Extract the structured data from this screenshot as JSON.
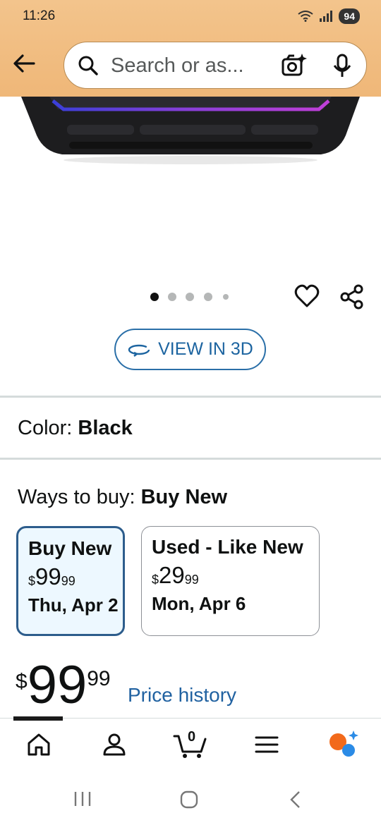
{
  "status_bar": {
    "time": "11:26",
    "battery": "94"
  },
  "search": {
    "placeholder": "Search or as..."
  },
  "color": {
    "label": "Color:",
    "value": "Black"
  },
  "view_3d": {
    "label": "VIEW IN 3D"
  },
  "ways_to_buy": {
    "label": "Ways to buy:",
    "selected": "Buy New",
    "options": [
      {
        "title": "Buy New",
        "currency": "$",
        "price_whole": "99",
        "price_fraction": "99",
        "delivery": "Thu, Apr 2"
      },
      {
        "title": "Used - Like New",
        "currency": "$",
        "price_whole": "29",
        "price_fraction": "99",
        "delivery": "Mon, Apr 6"
      }
    ]
  },
  "price": {
    "currency": "$",
    "whole": "99",
    "fraction": "99",
    "history_link": "Price history"
  },
  "cart": {
    "count": "0"
  },
  "carousel": {
    "total": 5,
    "active": 1
  },
  "colors": {
    "header": "#f0bc80",
    "accent_blue": "#2162a1",
    "selected_card": "#edf8ff"
  },
  "icons": [
    "back-arrow-icon",
    "search-icon",
    "camera-sparkle-icon",
    "microphone-icon",
    "heart-icon",
    "share-icon",
    "rotate-3d-icon",
    "home-icon",
    "account-icon",
    "cart-icon",
    "menu-icon",
    "ai-assistant-icon"
  ]
}
